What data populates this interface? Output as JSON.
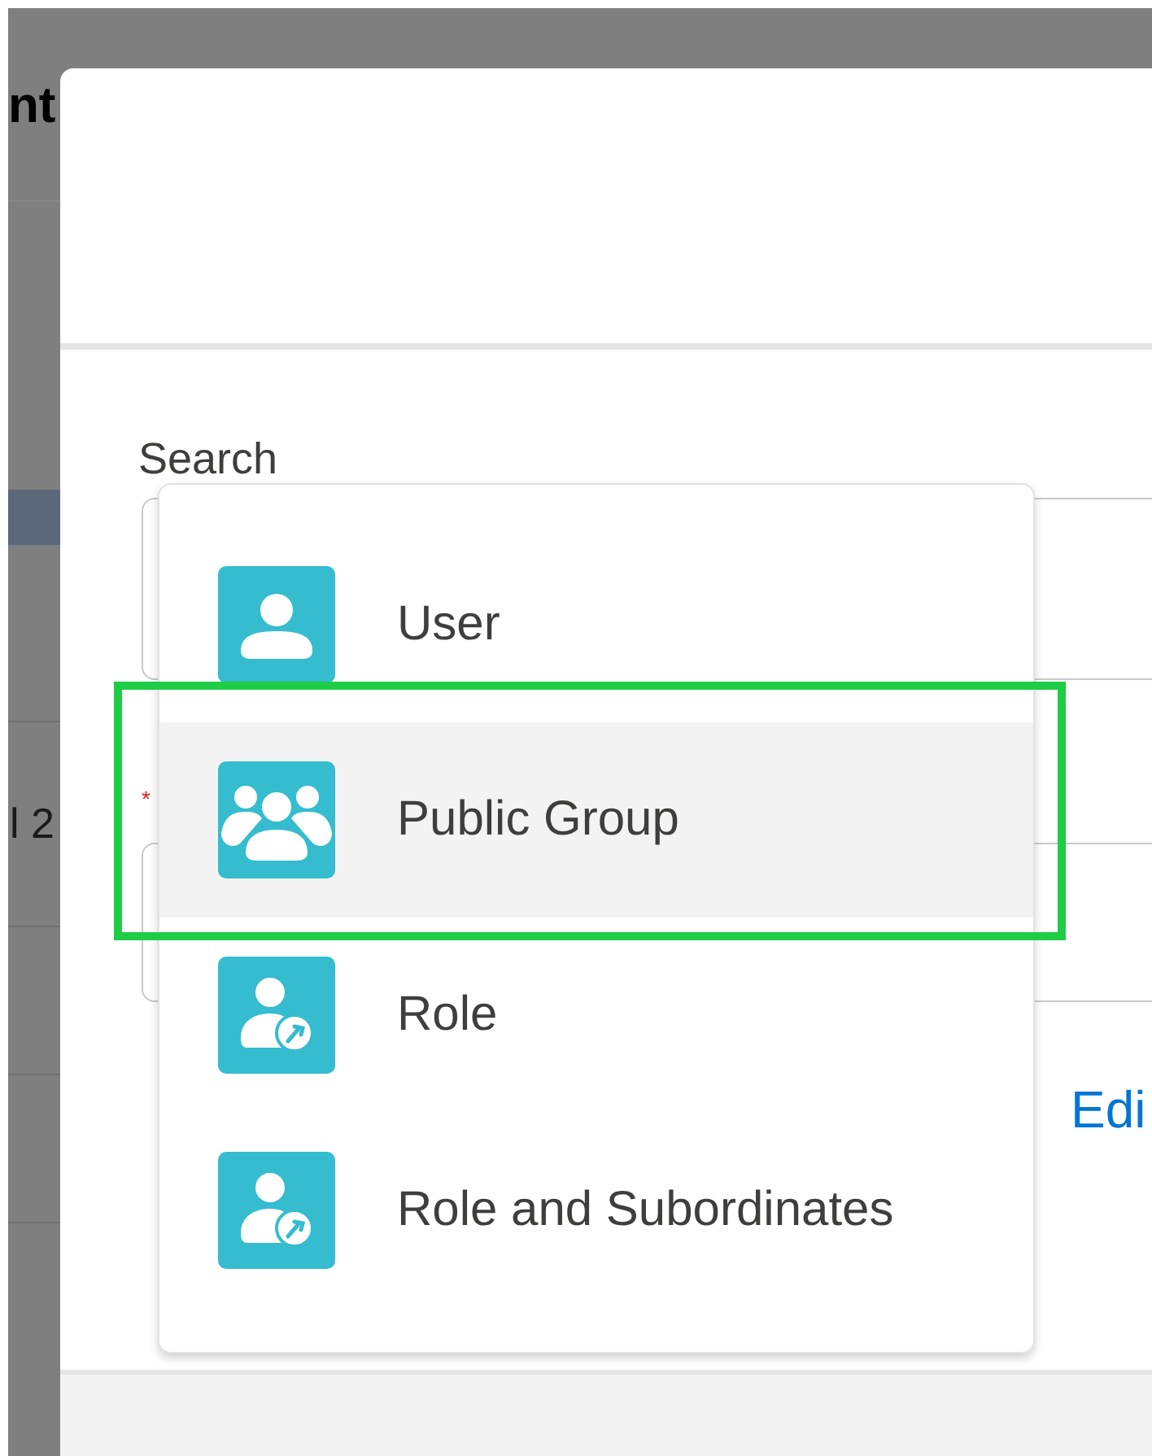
{
  "background_page": {
    "title": "nt",
    "cell": "l 2"
  },
  "modal": {
    "search_label": "Search",
    "required_mark": "*",
    "edit_link": "Edi"
  },
  "dropdown": {
    "items": [
      {
        "kind": "user",
        "label": "User",
        "selected": false
      },
      {
        "kind": "group",
        "label": "Public Group",
        "selected": true
      },
      {
        "kind": "role",
        "label": "Role",
        "selected": false
      },
      {
        "kind": "role",
        "label": "Role and Subordinates",
        "selected": false
      }
    ]
  }
}
